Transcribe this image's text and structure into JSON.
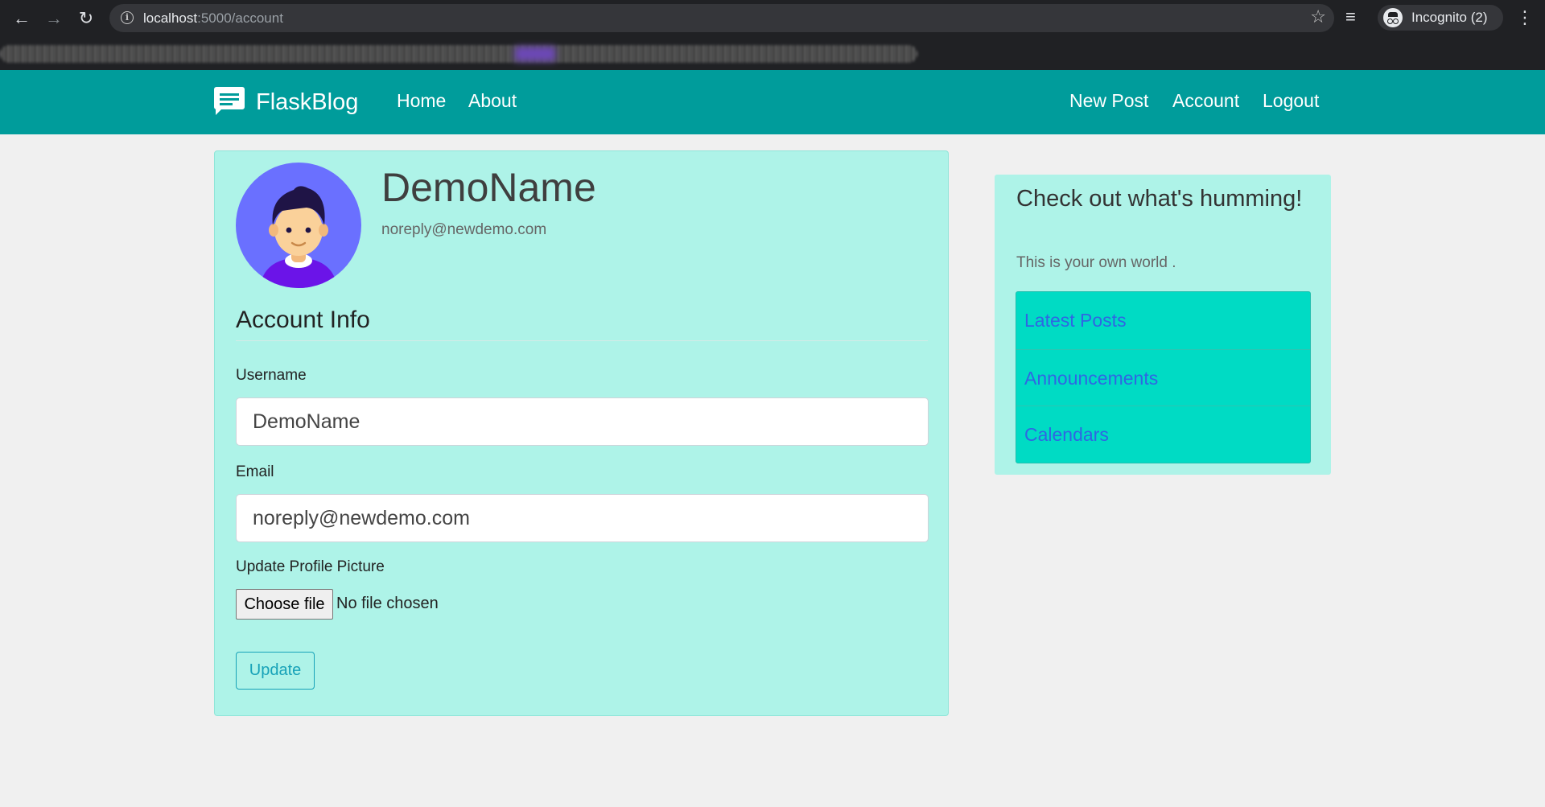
{
  "browser": {
    "url_host": "localhost",
    "url_path": ":5000/account",
    "profile_label": "Incognito (2)"
  },
  "navbar": {
    "brand": "FlaskBlog",
    "left_links": [
      "Home",
      "About"
    ],
    "right_links": [
      "New Post",
      "Account",
      "Logout"
    ],
    "background": "#009c9b"
  },
  "profile": {
    "name": "DemoName",
    "email": "noreply@newdemo.com"
  },
  "form": {
    "legend": "Account Info",
    "username_label": "Username",
    "username_value": "DemoName",
    "email_label": "Email",
    "email_value": "noreply@newdemo.com",
    "picture_label": "Update Profile Picture",
    "file_button": "Choose file",
    "file_status": "No file chosen",
    "submit_label": "Update"
  },
  "sidebar": {
    "title": "Check out what's humming!",
    "subtitle": "This is your own world .",
    "items": [
      "Latest Posts",
      "Announcements",
      "Calendars"
    ]
  },
  "colors": {
    "card_bg": "#aef3e8",
    "list_bg": "#00dbc4",
    "link": "#2f66e3",
    "accent": "#17a2b8"
  }
}
